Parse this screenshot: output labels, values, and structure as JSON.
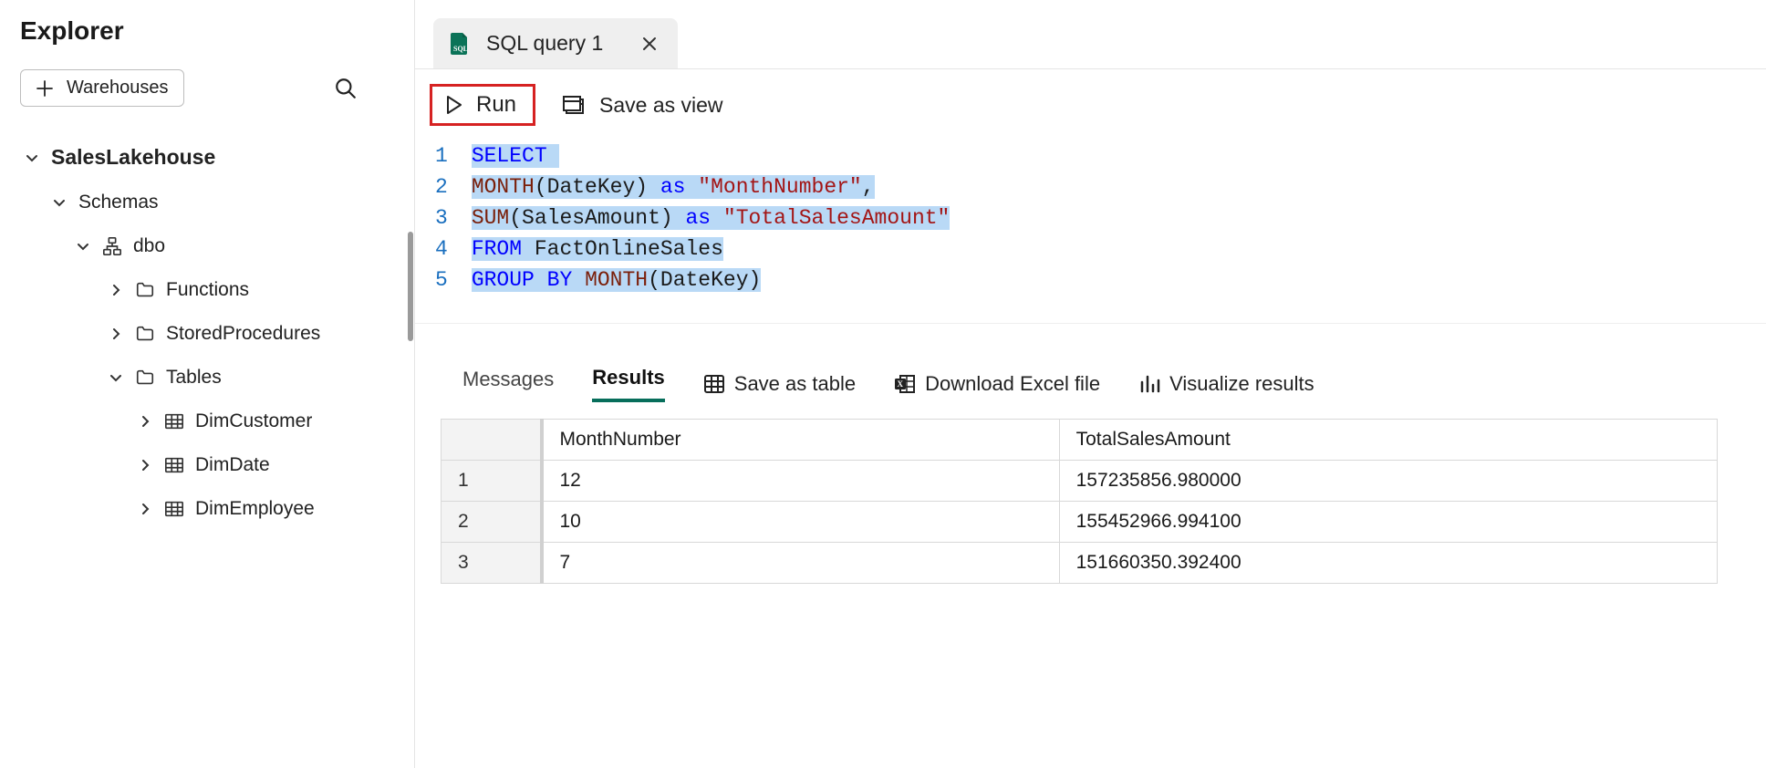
{
  "explorer": {
    "title": "Explorer",
    "warehouses_btn": "Warehouses",
    "tree": {
      "lakehouse": "SalesLakehouse",
      "schemas_label": "Schemas",
      "schema": "dbo",
      "folders": {
        "functions": "Functions",
        "stored_procedures": "StoredProcedures",
        "tables": "Tables"
      },
      "tables": [
        "DimCustomer",
        "DimDate",
        "DimEmployee"
      ]
    }
  },
  "tab": {
    "label": "SQL query 1"
  },
  "toolbar": {
    "run": "Run",
    "save_as_view": "Save as view"
  },
  "sql": {
    "lines": [
      {
        "n": "1",
        "tokens": [
          {
            "t": "SELECT",
            "c": "kw"
          },
          {
            "t": " ",
            "c": ""
          }
        ]
      },
      {
        "n": "2",
        "tokens": [
          {
            "t": "MONTH",
            "c": "fn"
          },
          {
            "t": "(",
            "c": ""
          },
          {
            "t": "DateKey",
            "c": ""
          },
          {
            "t": ") ",
            "c": ""
          },
          {
            "t": "as",
            "c": "kw"
          },
          {
            "t": " ",
            "c": ""
          },
          {
            "t": "\"MonthNumber\"",
            "c": "lit"
          },
          {
            "t": ",",
            "c": ""
          }
        ]
      },
      {
        "n": "3",
        "tokens": [
          {
            "t": "SUM",
            "c": "fn"
          },
          {
            "t": "(",
            "c": ""
          },
          {
            "t": "SalesAmount",
            "c": ""
          },
          {
            "t": ") ",
            "c": ""
          },
          {
            "t": "as",
            "c": "kw"
          },
          {
            "t": " ",
            "c": ""
          },
          {
            "t": "\"TotalSalesAmount\"",
            "c": "lit"
          }
        ]
      },
      {
        "n": "4",
        "tokens": [
          {
            "t": "FROM",
            "c": "kw"
          },
          {
            "t": " FactOnlineSales",
            "c": ""
          }
        ]
      },
      {
        "n": "5",
        "tokens": [
          {
            "t": "GROUP",
            "c": "kw"
          },
          {
            "t": " ",
            "c": ""
          },
          {
            "t": "BY",
            "c": "kw"
          },
          {
            "t": " ",
            "c": ""
          },
          {
            "t": "MONTH",
            "c": "fn"
          },
          {
            "t": "(",
            "c": ""
          },
          {
            "t": "DateKey",
            "c": ""
          },
          {
            "t": ")",
            "c": ""
          }
        ]
      }
    ]
  },
  "results_bar": {
    "messages": "Messages",
    "results": "Results",
    "save_as_table": "Save as table",
    "download_excel": "Download Excel file",
    "visualize": "Visualize results"
  },
  "results": {
    "columns": [
      "MonthNumber",
      "TotalSalesAmount"
    ],
    "rows": [
      {
        "n": "1",
        "cells": [
          "12",
          "157235856.980000"
        ]
      },
      {
        "n": "2",
        "cells": [
          "10",
          "155452966.994100"
        ]
      },
      {
        "n": "3",
        "cells": [
          "7",
          "151660350.392400"
        ]
      }
    ]
  }
}
